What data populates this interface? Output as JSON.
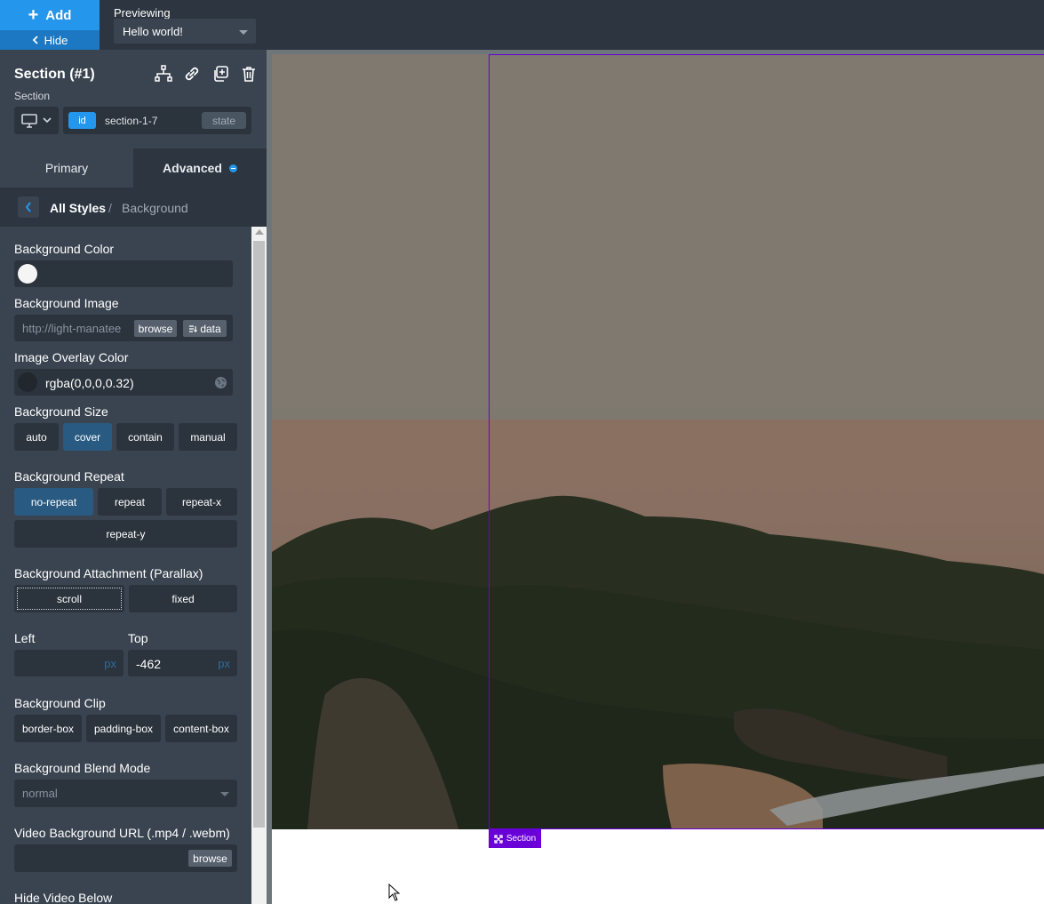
{
  "topbar": {
    "add_label": "Add",
    "hide_label": "Hide",
    "previewing_label": "Previewing",
    "preview_value": "Hello world!"
  },
  "element": {
    "title": "Section (#1)",
    "type": "Section",
    "id_badge": "id",
    "id_value": "section-1-7",
    "state_label": "state"
  },
  "tabs": {
    "primary": "Primary",
    "advanced": "Advanced"
  },
  "breadcrumb": {
    "root": "All Styles",
    "separator": "/",
    "current": "Background"
  },
  "fields": {
    "bg_color": {
      "label": "Background Color",
      "swatch": "#f5f5f5"
    },
    "bg_image": {
      "label": "Background Image",
      "value": "http://light-manatee",
      "browse": "browse",
      "data": "data"
    },
    "overlay": {
      "label": "Image Overlay Color",
      "value": "rgba(0,0,0,0.32)",
      "swatch": "#22272e"
    },
    "size": {
      "label": "Background Size",
      "options": [
        "auto",
        "cover",
        "contain",
        "manual"
      ],
      "selected": "cover"
    },
    "repeat": {
      "label": "Background Repeat",
      "options": [
        "no-repeat",
        "repeat",
        "repeat-x",
        "repeat-y"
      ],
      "selected": "no-repeat"
    },
    "attachment": {
      "label": "Background Attachment (Parallax)",
      "options": [
        "scroll",
        "fixed"
      ],
      "focused": "scroll"
    },
    "left": {
      "label": "Left",
      "value": "",
      "unit": "px"
    },
    "top": {
      "label": "Top",
      "value": "-462",
      "unit": "px"
    },
    "clip": {
      "label": "Background Clip",
      "options": [
        "border-box",
        "padding-box",
        "content-box"
      ]
    },
    "blend": {
      "label": "Background Blend Mode",
      "value": "normal"
    },
    "video": {
      "label": "Video Background URL (.mp4 / .webm)",
      "browse": "browse"
    },
    "hide_video": {
      "label": "Hide Video Below"
    }
  },
  "canvas": {
    "selection_tag": "Section",
    "selection_color": "#6a00d8"
  },
  "colors": {
    "accent": "#2496ec",
    "selected_segment": "#295b82"
  }
}
